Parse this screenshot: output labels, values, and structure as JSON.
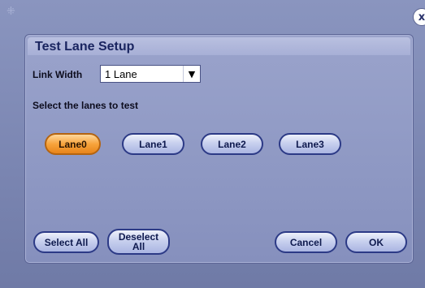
{
  "window": {
    "close_glyph": "x"
  },
  "dialog": {
    "title": "Test Lane Setup",
    "link_width": {
      "label": "Link Width",
      "value": "1 Lane",
      "arrow_glyph": "▼"
    },
    "instruction": "Select the lanes to test",
    "lanes": [
      {
        "label": "Lane0",
        "selected": true
      },
      {
        "label": "Lane1",
        "selected": false
      },
      {
        "label": "Lane2",
        "selected": false
      },
      {
        "label": "Lane3",
        "selected": false
      }
    ],
    "buttons": {
      "select_all": "Select All",
      "deselect_all": "Deselect All",
      "cancel": "Cancel",
      "ok": "OK"
    }
  },
  "colors": {
    "selected_lane": "#f7a43c",
    "button_face": "#c8d0ee",
    "dialog_bg": "#9aa3cb",
    "title_text": "#1a2560"
  },
  "icons": {
    "corner": "drag-corner-icon",
    "close": "close-icon",
    "dropdown": "chevron-down-icon"
  }
}
